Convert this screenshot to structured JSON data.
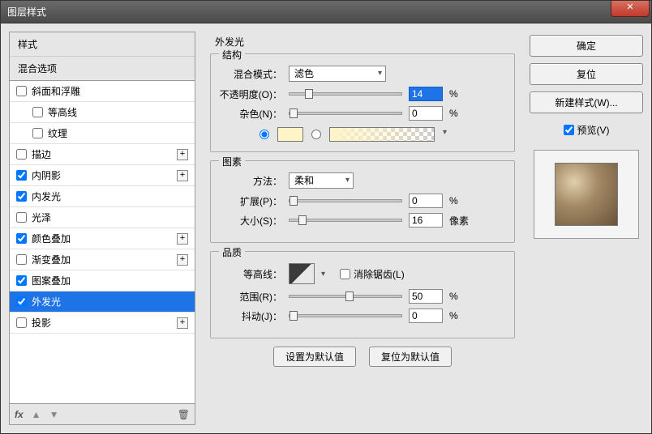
{
  "window": {
    "title": "图层样式"
  },
  "left": {
    "header_styles": "样式",
    "header_blend": "混合选项",
    "items": [
      {
        "label": "斜面和浮雕",
        "checked": false,
        "plus": false,
        "indent": false
      },
      {
        "label": "等高线",
        "checked": false,
        "plus": false,
        "indent": true
      },
      {
        "label": "纹理",
        "checked": false,
        "plus": false,
        "indent": true
      },
      {
        "label": "描边",
        "checked": false,
        "plus": true,
        "indent": false
      },
      {
        "label": "内阴影",
        "checked": true,
        "plus": true,
        "indent": false
      },
      {
        "label": "内发光",
        "checked": true,
        "plus": false,
        "indent": false
      },
      {
        "label": "光泽",
        "checked": false,
        "plus": false,
        "indent": false
      },
      {
        "label": "颜色叠加",
        "checked": true,
        "plus": true,
        "indent": false
      },
      {
        "label": "渐变叠加",
        "checked": false,
        "plus": true,
        "indent": false
      },
      {
        "label": "图案叠加",
        "checked": true,
        "plus": false,
        "indent": false
      },
      {
        "label": "外发光",
        "checked": true,
        "plus": false,
        "indent": false,
        "selected": true
      },
      {
        "label": "投影",
        "checked": false,
        "plus": true,
        "indent": false
      }
    ],
    "footer_fx": "fx"
  },
  "middle": {
    "title": "外发光",
    "group_structure": "结构",
    "blend_mode_label": "混合模式：",
    "blend_mode_value": "滤色",
    "opacity_label": "不透明度(O)：",
    "opacity_value": "14",
    "opacity_unit": "%",
    "noise_label": "杂色(N)：",
    "noise_value": "0",
    "noise_unit": "%",
    "color_solid": "#fff4c8",
    "group_elements": "图素",
    "technique_label": "方法：",
    "technique_value": "柔和",
    "spread_label": "扩展(P)：",
    "spread_value": "0",
    "spread_unit": "%",
    "size_label": "大小(S)：",
    "size_value": "16",
    "size_unit": "像素",
    "group_quality": "品质",
    "contour_label": "等高线：",
    "antialias_label": "消除锯齿(L)",
    "range_label": "范围(R)：",
    "range_value": "50",
    "range_unit": "%",
    "jitter_label": "抖动(J)：",
    "jitter_value": "0",
    "jitter_unit": "%",
    "btn_default": "设置为默认值",
    "btn_reset": "复位为默认值"
  },
  "right": {
    "ok": "确定",
    "cancel": "复位",
    "new_style": "新建样式(W)...",
    "preview": "预览(V)"
  }
}
